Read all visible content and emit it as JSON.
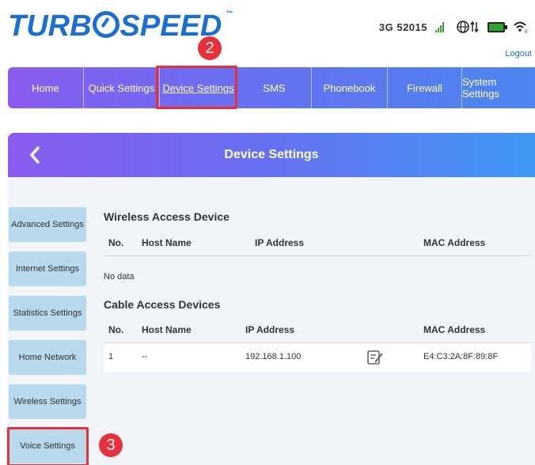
{
  "header": {
    "logo_text_1": "TURB",
    "logo_text_2": "SPEED",
    "logo_tm": "™",
    "network": "3G  52015",
    "logout": "Logout"
  },
  "nav": {
    "items": [
      {
        "label": "Home"
      },
      {
        "label": "Quick Settings"
      },
      {
        "label": "Device Settings"
      },
      {
        "label": "SMS"
      },
      {
        "label": "Phonebook"
      },
      {
        "label": "Firewall"
      },
      {
        "label": "System Settings"
      }
    ],
    "active": "Device Settings"
  },
  "annotations": {
    "step2": "2",
    "step3": "3",
    "highlight_color": "#e8303a"
  },
  "page": {
    "back_icon": "chevron-left-icon",
    "title": "Device Settings"
  },
  "sidebar": {
    "items": [
      {
        "label": "Advanced Settings"
      },
      {
        "label": "Internet Settings"
      },
      {
        "label": "Statistics Settings"
      },
      {
        "label": "Home Network"
      },
      {
        "label": "Wireless Settings"
      },
      {
        "label": "Voice Settings"
      }
    ]
  },
  "wireless": {
    "title": "Wireless Access Device",
    "columns": [
      "No.",
      "Host Name",
      "IP Address",
      "MAC Address"
    ],
    "empty": "No data"
  },
  "cable": {
    "title": "Cable Access Devices",
    "columns": [
      "No.",
      "Host Name",
      "IP Address",
      "MAC Address"
    ],
    "rows": [
      {
        "no": "1",
        "host": "--",
        "ip": "192.168.1.100",
        "mac": "E4:C3:2A:8F:89:8F",
        "edit_icon": "edit-icon"
      }
    ]
  },
  "colors": {
    "brand": "#1b6fd0",
    "nav_gradient_start": "#8a5cf0",
    "nav_gradient_end": "#4c86f0",
    "sidebar_button": "#b8d8ec",
    "signal": "#2ea52e"
  }
}
